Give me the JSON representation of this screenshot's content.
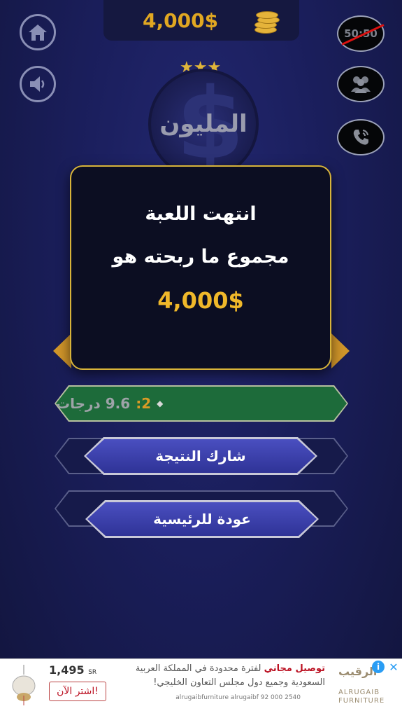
{
  "header": {
    "balance": "4,000$",
    "lifelines": {
      "fifty_fifty": "50:50"
    }
  },
  "logo": {
    "name": "المليون",
    "symbol": "$"
  },
  "modal": {
    "title": "انتهت اللعبة",
    "subtitle": "مجموع ما ربحته هو",
    "prize": "4,000$"
  },
  "answer_row": {
    "number": "2:",
    "text": "9.6 درجات"
  },
  "buttons": {
    "share": "شارك النتيجة",
    "home": "عودة للرئيسية"
  },
  "ad": {
    "price": "1,495",
    "currency": "SR",
    "buy_label": "اشتر الآن!",
    "headline_highlight": "توصيل مجاني",
    "headline_rest": "لفترة محدودة في المملكة العربية",
    "line2": "السعودية وجميع دول مجلس التعاون الخليجي!",
    "social": "alrugaibfurniture   alrugaibf   92 000 2540",
    "brand_ar": "الرقيب",
    "brand_en": "ALRUGAIB FURNITURE"
  },
  "colors": {
    "gold": "#f0b82a",
    "button_blue": "#3a3fae",
    "correct_green": "#1d6b3a",
    "background": "#1b1f5e"
  }
}
